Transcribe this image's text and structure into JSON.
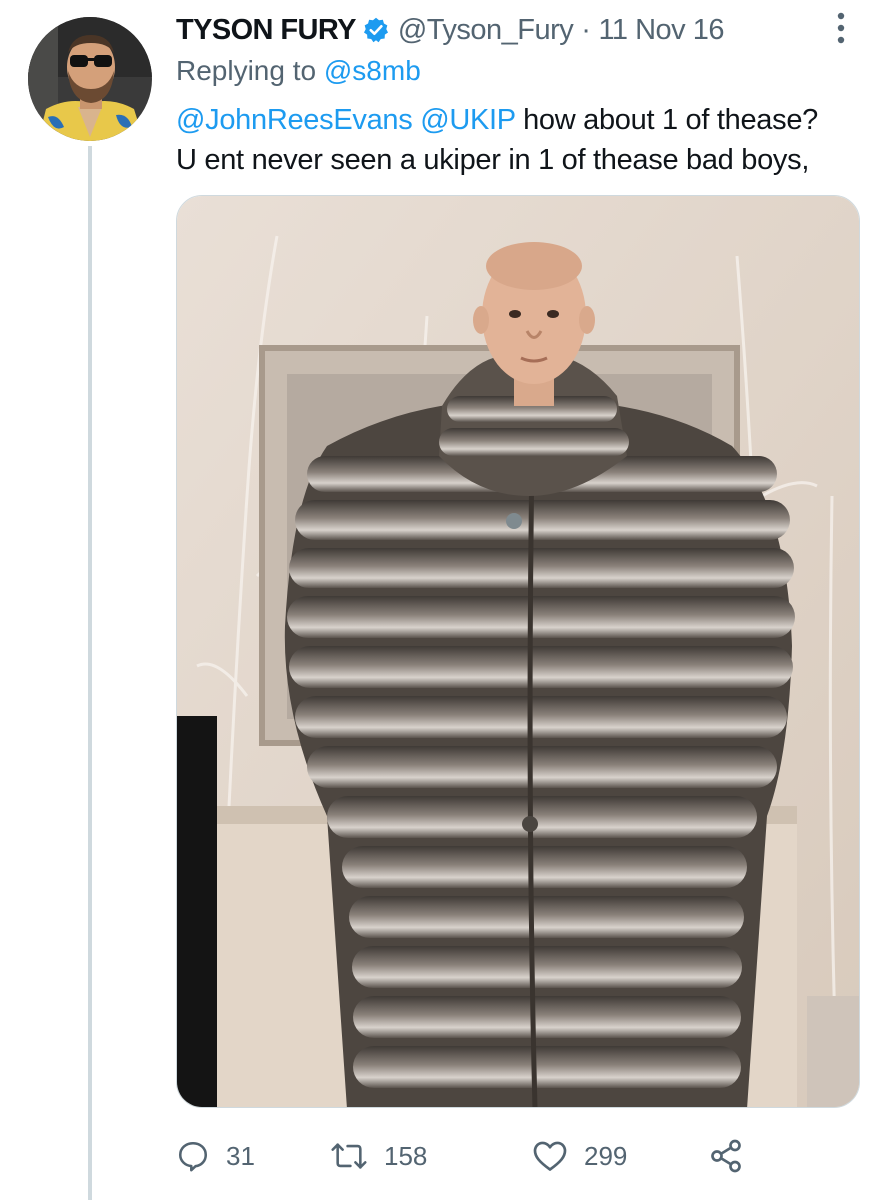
{
  "tweet": {
    "author_name": "TYSON FURY",
    "handle": "@Tyson_Fury",
    "separator": "·",
    "date": "11 Nov 16",
    "replying_prefix": "Replying to ",
    "replying_to": "@s8mb",
    "text": {
      "mention_1": "@JohnReesEvans",
      "mention_2": "@UKIP",
      "line_1_rest": " how about 1 of thease?",
      "line_2": "U ent never seen a ukiper in 1 of thease bad boys,"
    }
  },
  "actions": {
    "reply_count": "31",
    "retweet_count": "158",
    "like_count": "299"
  },
  "icons": {
    "verified": "verified-badge-icon",
    "more": "more-options-icon",
    "reply": "reply-icon",
    "retweet": "retweet-icon",
    "like": "heart-icon",
    "share": "share-icon"
  },
  "colors": {
    "accent": "#1d9bf0",
    "text": "#0f1419",
    "secondary": "#536471",
    "thread_line": "#cfd9de"
  }
}
